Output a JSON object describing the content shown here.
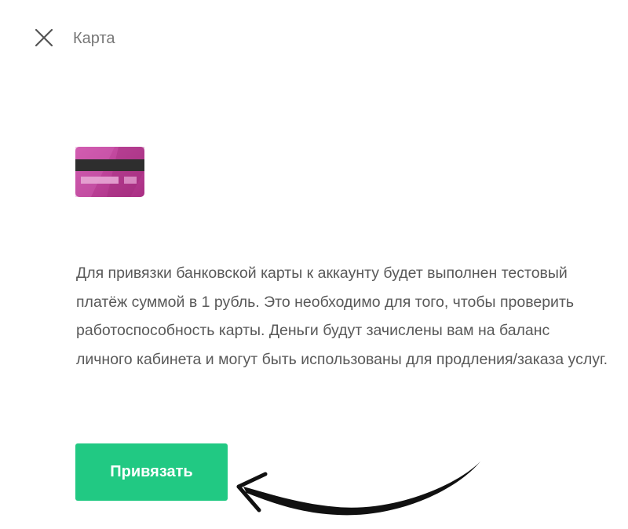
{
  "header": {
    "title": "Карта",
    "close_icon": "close-icon"
  },
  "card": {
    "icon": "bank-card-icon",
    "colors": {
      "card": "#b93c92",
      "card_highlight": "#d25fb4",
      "stripe": "#2e2e2e"
    }
  },
  "description": {
    "text": "Для привязки банковской карты к аккаунту будет выполнен тестовый платёж суммой в 1 рубль. Это необходимо для того, чтобы проверить работоспособность карты. Деньги будут зачислены вам на баланс личного кабинета и могут быть использованы для продления/заказа услуг."
  },
  "actions": {
    "bind_label": "Привязать",
    "bind_color": "#21c983"
  },
  "annotation": {
    "icon": "curved-arrow-icon",
    "color": "#111111"
  }
}
